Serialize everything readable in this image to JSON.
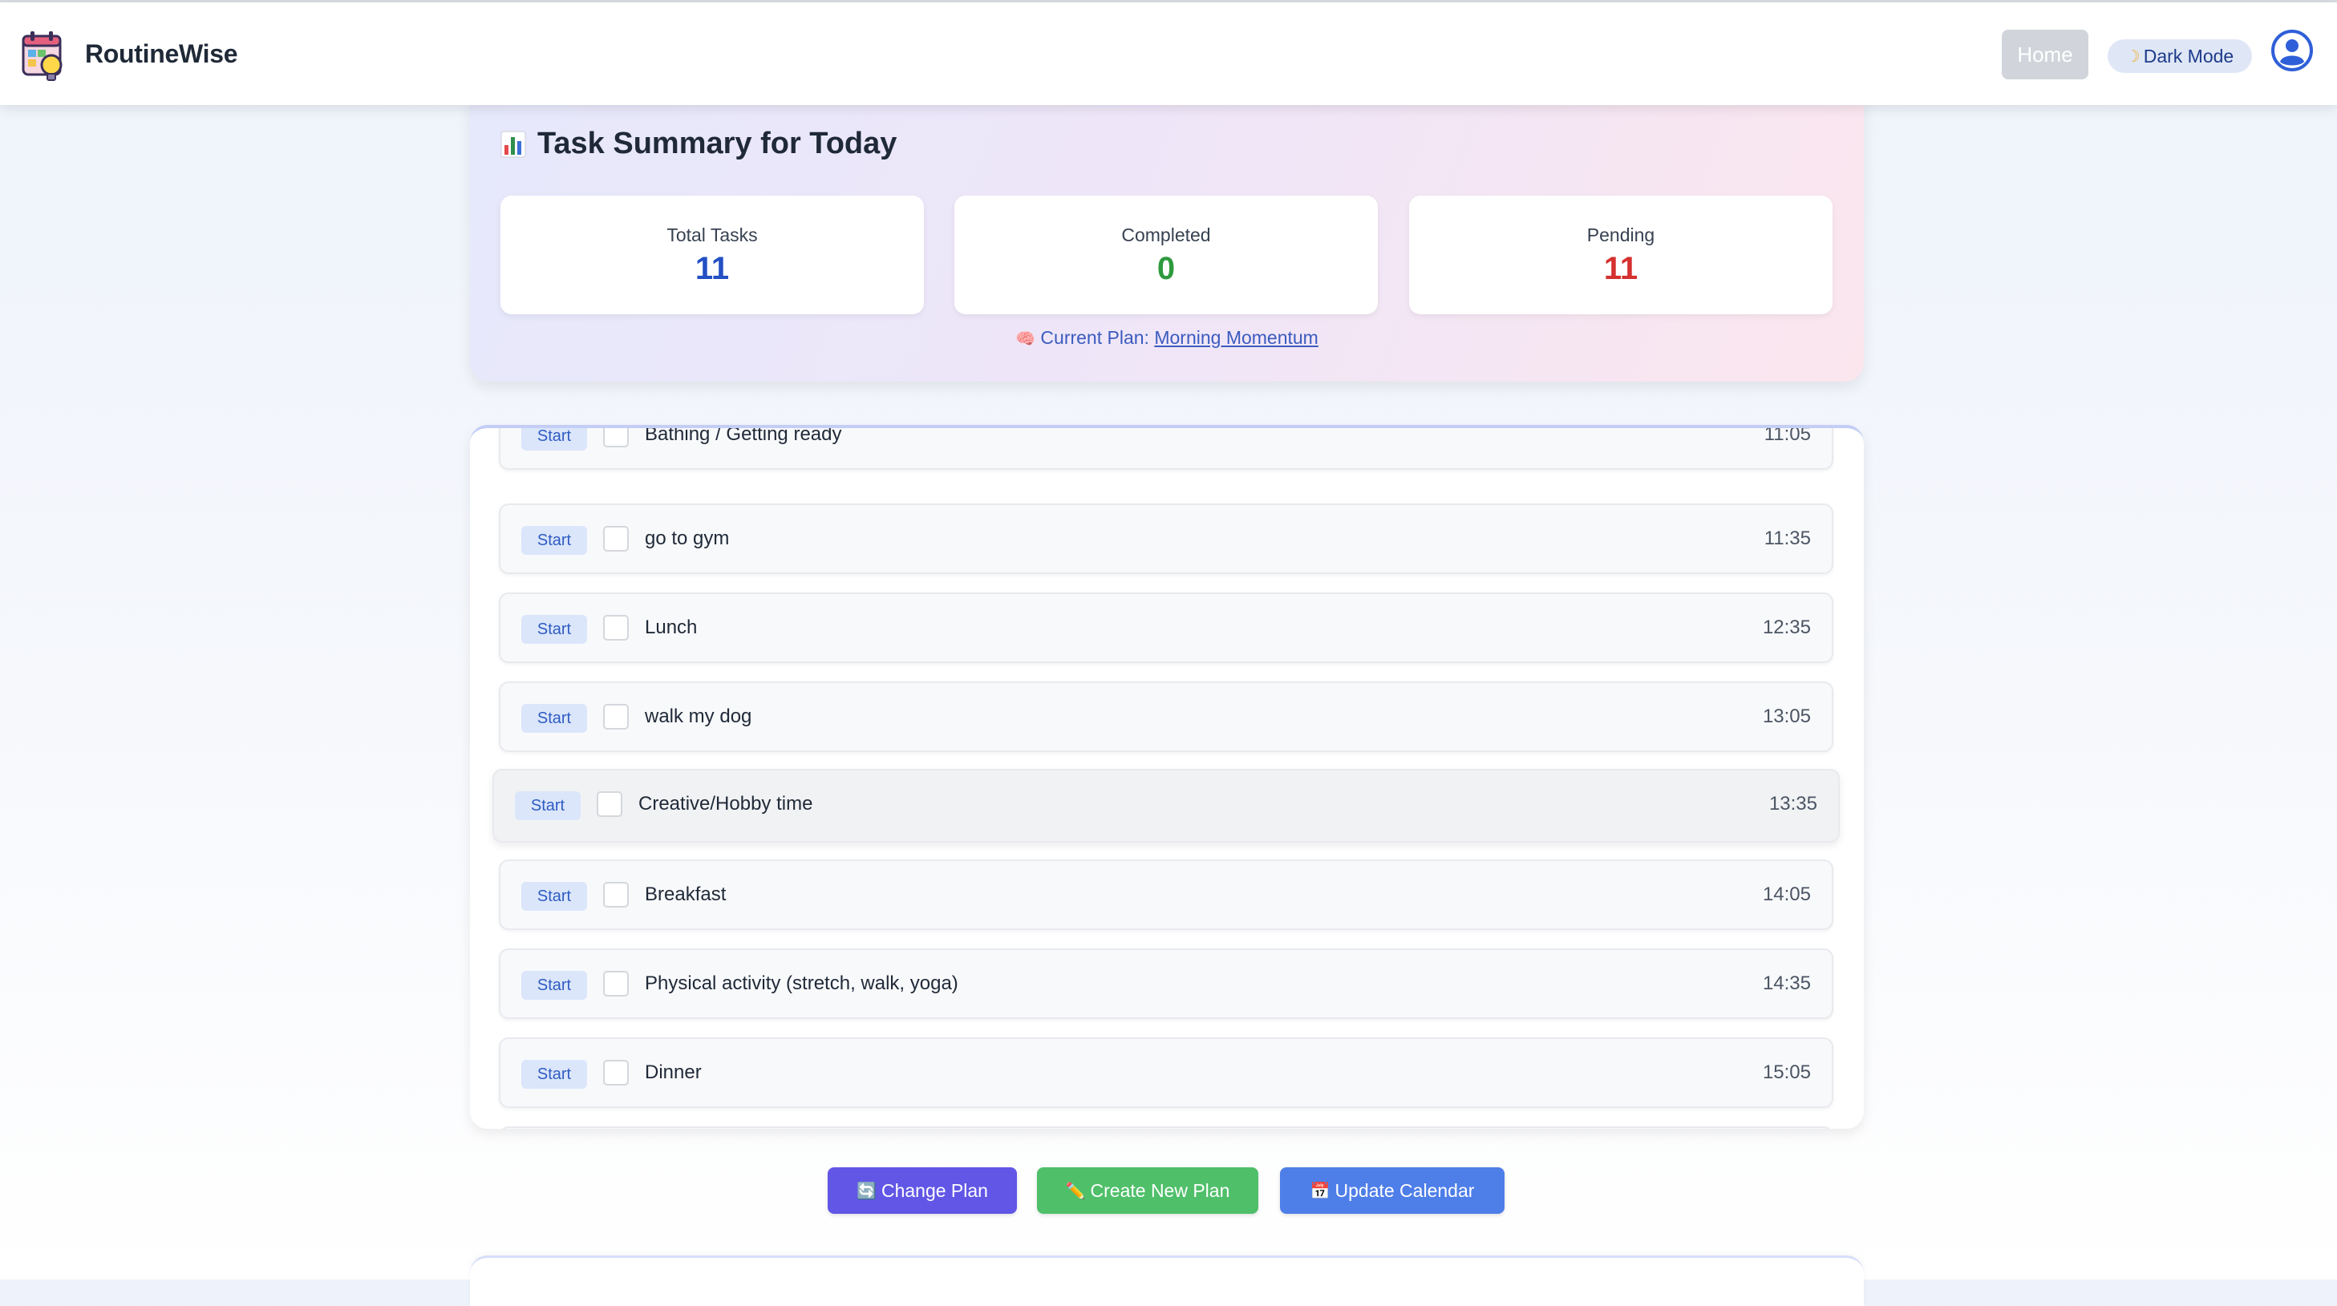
{
  "header": {
    "app_name": "RoutineWise",
    "home_label": "Home",
    "dark_mode_label": "Dark Mode"
  },
  "summary": {
    "title": "Task Summary for Today",
    "stats": [
      {
        "label": "Total Tasks",
        "value": "11"
      },
      {
        "label": "Completed",
        "value": "0"
      },
      {
        "label": "Pending",
        "value": "11"
      }
    ],
    "current_plan_label": "Current Plan:",
    "current_plan_name": "Morning Momentum"
  },
  "tasks": {
    "start_label": "Start",
    "items": [
      {
        "name": "Bathing / Getting ready",
        "time": "11:05"
      },
      {
        "name": "go to gym",
        "time": "11:35"
      },
      {
        "name": "Lunch",
        "time": "12:35"
      },
      {
        "name": "walk my dog",
        "time": "13:05"
      },
      {
        "name": "Creative/Hobby time",
        "time": "13:35"
      },
      {
        "name": "Breakfast",
        "time": "14:05"
      },
      {
        "name": "Physical activity (stretch, walk, yoga)",
        "time": "14:35"
      },
      {
        "name": "Dinner",
        "time": "15:05"
      }
    ]
  },
  "actions": {
    "change_plan": "Change Plan",
    "create_plan": "Create New Plan",
    "update_calendar": "Update Calendar"
  },
  "colors": {
    "total": "#2450c4",
    "completed": "#2e9a3e",
    "pending": "#d63030",
    "change_plan": "#6156e6",
    "create_plan": "#4fbf6a",
    "update_calendar": "#4e7ee8"
  },
  "icons": {
    "logo": "calendar-lightbulb-icon",
    "summary": "bar-chart-icon",
    "plan": "brain-icon",
    "user": "user-avatar-icon"
  }
}
